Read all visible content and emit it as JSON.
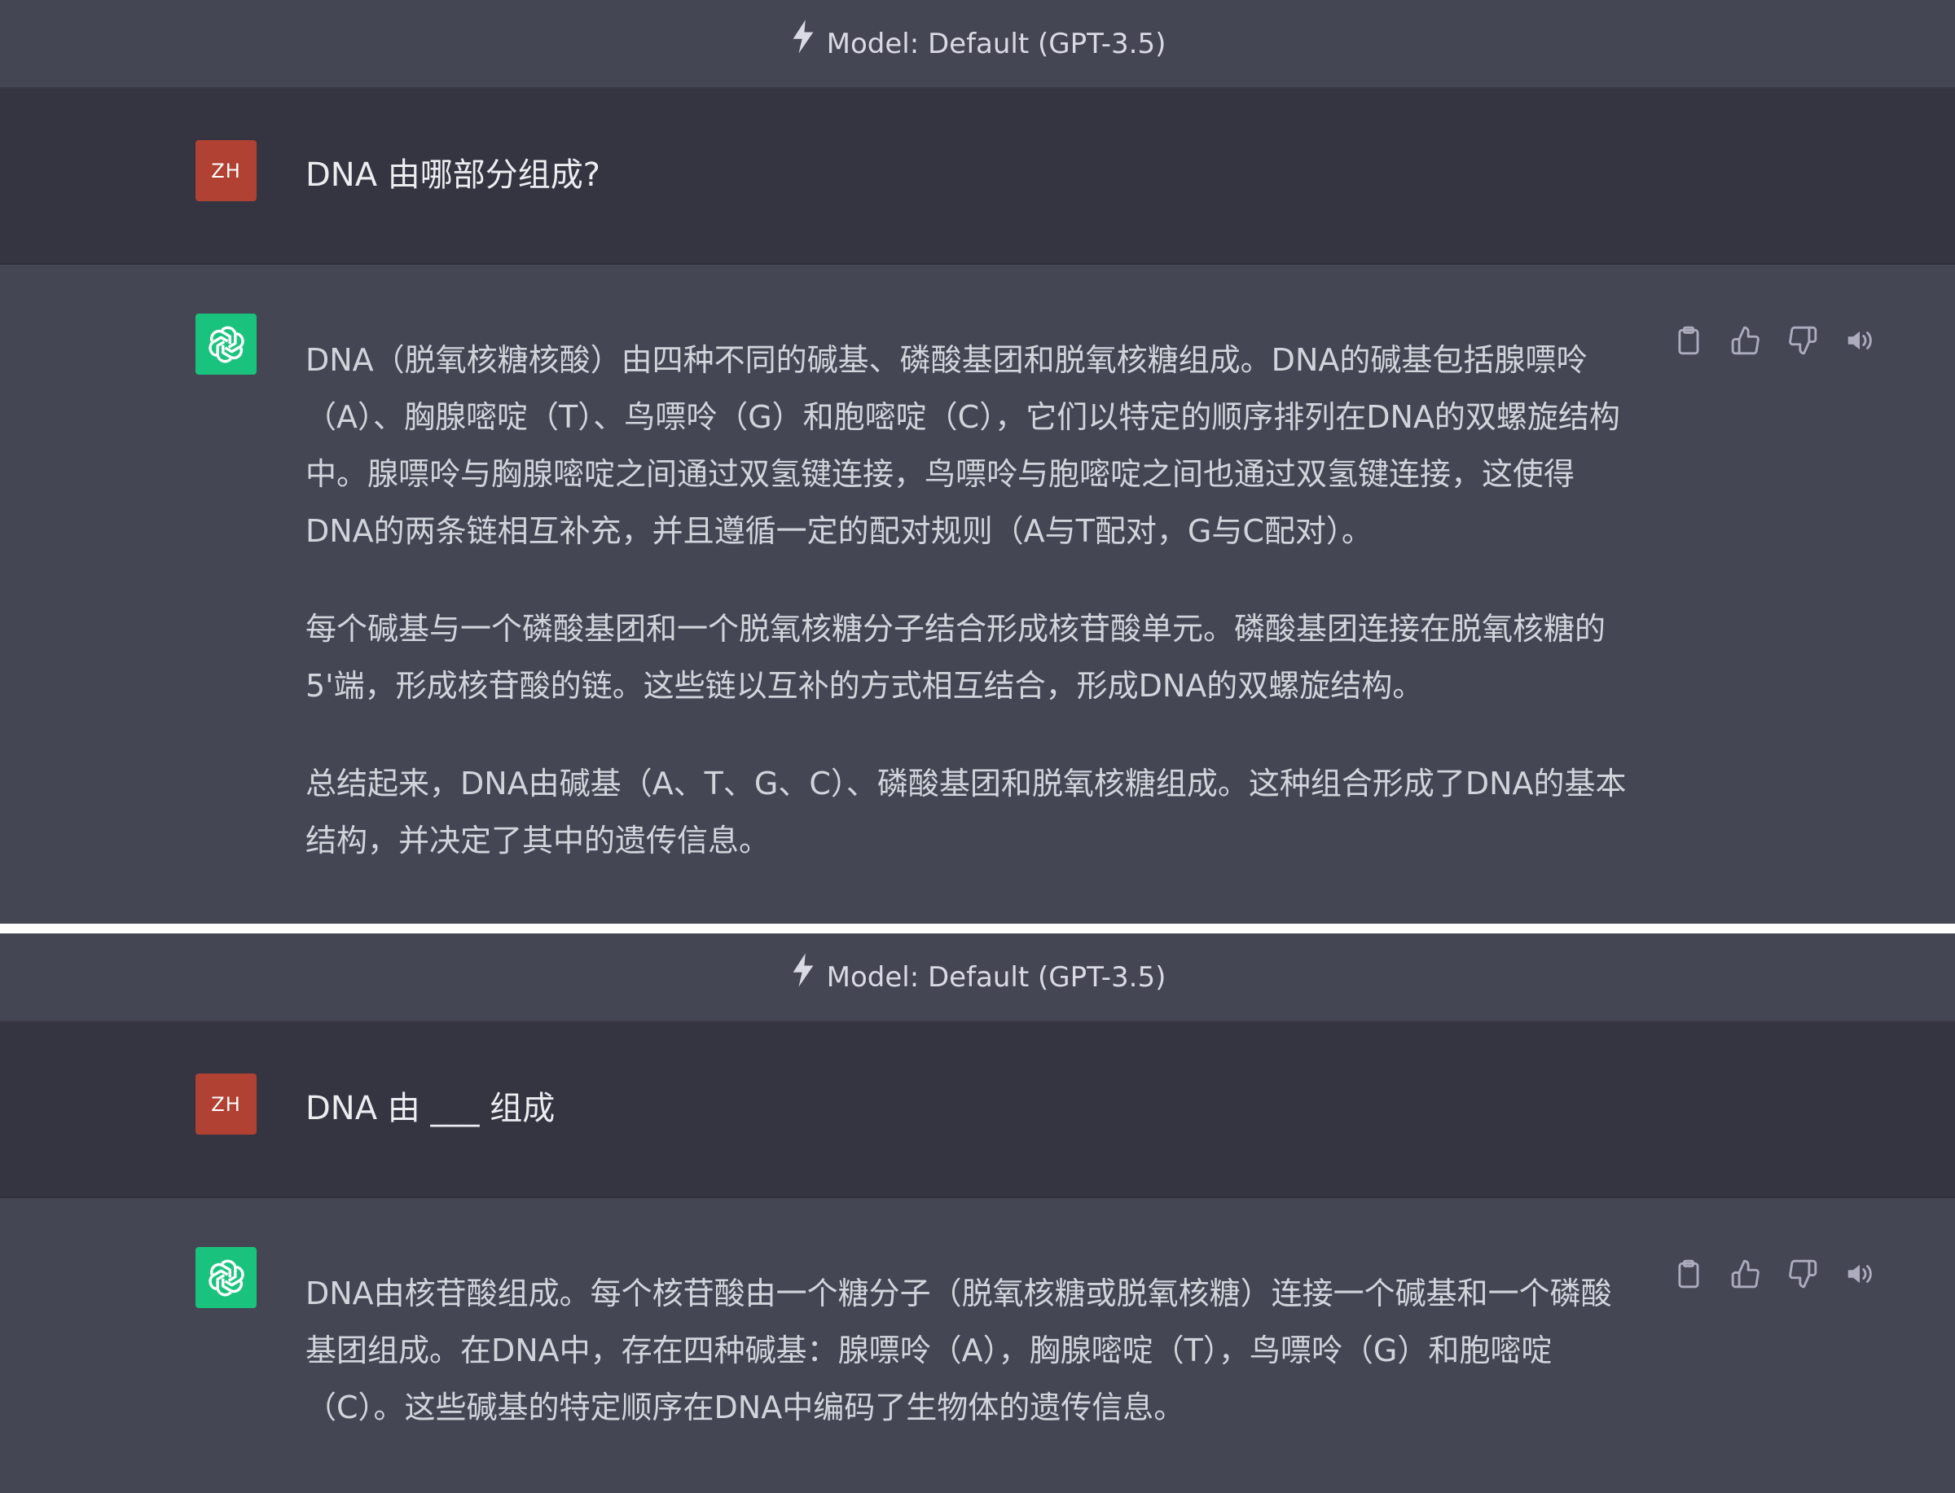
{
  "colors": {
    "panel_bg": "#444654",
    "user_row_bg": "#343541",
    "user_avatar_bg": "#b14132",
    "assistant_avatar_bg": "#19c37d",
    "text": "#d1d5db",
    "separator": "#ffffff"
  },
  "conversations": [
    {
      "model_label": "Model: Default (GPT-3.5)",
      "user": {
        "avatar": "ZH",
        "text": "DNA 由哪部分组成?"
      },
      "assistant": {
        "icon": "openai-logo-icon",
        "paragraphs": [
          "DNA（脱氧核糖核酸）由四种不同的碱基、磷酸基团和脱氧核糖组成。DNA的碱基包括腺嘌呤（A）、胸腺嘧啶（T）、鸟嘌呤（G）和胞嘧啶（C），它们以特定的顺序排列在DNA的双螺旋结构中。腺嘌呤与胸腺嘧啶之间通过双氢键连接，鸟嘌呤与胞嘧啶之间也通过双氢键连接，这使得DNA的两条链相互补充，并且遵循一定的配对规则（A与T配对，G与C配对）。",
          "每个碱基与一个磷酸基团和一个脱氧核糖分子结合形成核苷酸单元。磷酸基团连接在脱氧核糖的5'端，形成核苷酸的链。这些链以互补的方式相互结合，形成DNA的双螺旋结构。",
          "总结起来，DNA由碱基（A、T、G、C）、磷酸基团和脱氧核糖组成。这种组合形成了DNA的基本结构，并决定了其中的遗传信息。"
        ],
        "actions": [
          "clipboard-icon",
          "thumbs-up-icon",
          "thumbs-down-icon",
          "speaker-icon"
        ]
      }
    },
    {
      "model_label": "Model: Default (GPT-3.5)",
      "user": {
        "avatar": "ZH",
        "text": "DNA 由 ___ 组成"
      },
      "assistant": {
        "icon": "openai-logo-icon",
        "paragraphs": [
          "DNA由核苷酸组成。每个核苷酸由一个糖分子（脱氧核糖或脱氧核糖）连接一个碱基和一个磷酸基团组成。在DNA中，存在四种碱基：腺嘌呤（A），胸腺嘧啶（T），鸟嘌呤（G）和胞嘧啶（C）。这些碱基的特定顺序在DNA中编码了生物体的遗传信息。"
        ],
        "actions": [
          "clipboard-icon",
          "thumbs-up-icon",
          "thumbs-down-icon",
          "speaker-icon"
        ]
      }
    }
  ]
}
